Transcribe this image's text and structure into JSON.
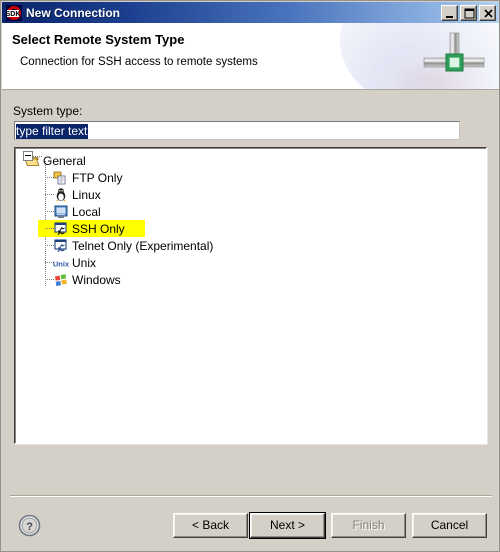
{
  "window": {
    "title": "New Connection",
    "app_icon": "sdk-icon",
    "controls": [
      {
        "name": "minimize-button",
        "glyph": "minimize-icon"
      },
      {
        "name": "maximize-button",
        "glyph": "maximize-icon"
      },
      {
        "name": "close-button",
        "glyph": "close-icon"
      }
    ]
  },
  "banner": {
    "title": "Select Remote System Type",
    "subtitle": "Connection for SSH access to remote systems",
    "graphic": "network-connector-icon"
  },
  "form": {
    "system_type_label": "System type:",
    "filter": {
      "value": "type filter text",
      "placeholder": "type filter text",
      "selected": true
    }
  },
  "tree": {
    "root": {
      "label": "General",
      "icon": "open-folder-icon",
      "expanded": true
    },
    "items": [
      {
        "label": "FTP Only",
        "icon": "ftp-icon",
        "highlighted": false
      },
      {
        "label": "Linux",
        "icon": "linux-penguin-icon",
        "highlighted": false
      },
      {
        "label": "Local",
        "icon": "monitor-icon",
        "highlighted": false
      },
      {
        "label": "SSH Only",
        "icon": "ssh-monitor-icon",
        "highlighted": true
      },
      {
        "label": "Telnet Only (Experimental)",
        "icon": "telnet-monitor-icon",
        "highlighted": false
      },
      {
        "label": "Unix",
        "icon": "unix-text-icon",
        "highlighted": false
      },
      {
        "label": "Windows",
        "icon": "windows-flag-icon",
        "highlighted": false
      }
    ]
  },
  "footer": {
    "help_label": "?",
    "back_label": "< Back",
    "next_label": "Next >",
    "finish_label": "Finish",
    "cancel_label": "Cancel",
    "finish_enabled": false,
    "default_button": "Next >"
  },
  "colors": {
    "dialog_background": "#d4d0c8",
    "titlebar_start": "#09246b",
    "titlebar_end": "#b6d2f0",
    "highlight_yellow": "#ffff00",
    "selection_blue": "#0a246a",
    "field_white": "#ffffff",
    "connector_green": "#2e9e5b"
  }
}
